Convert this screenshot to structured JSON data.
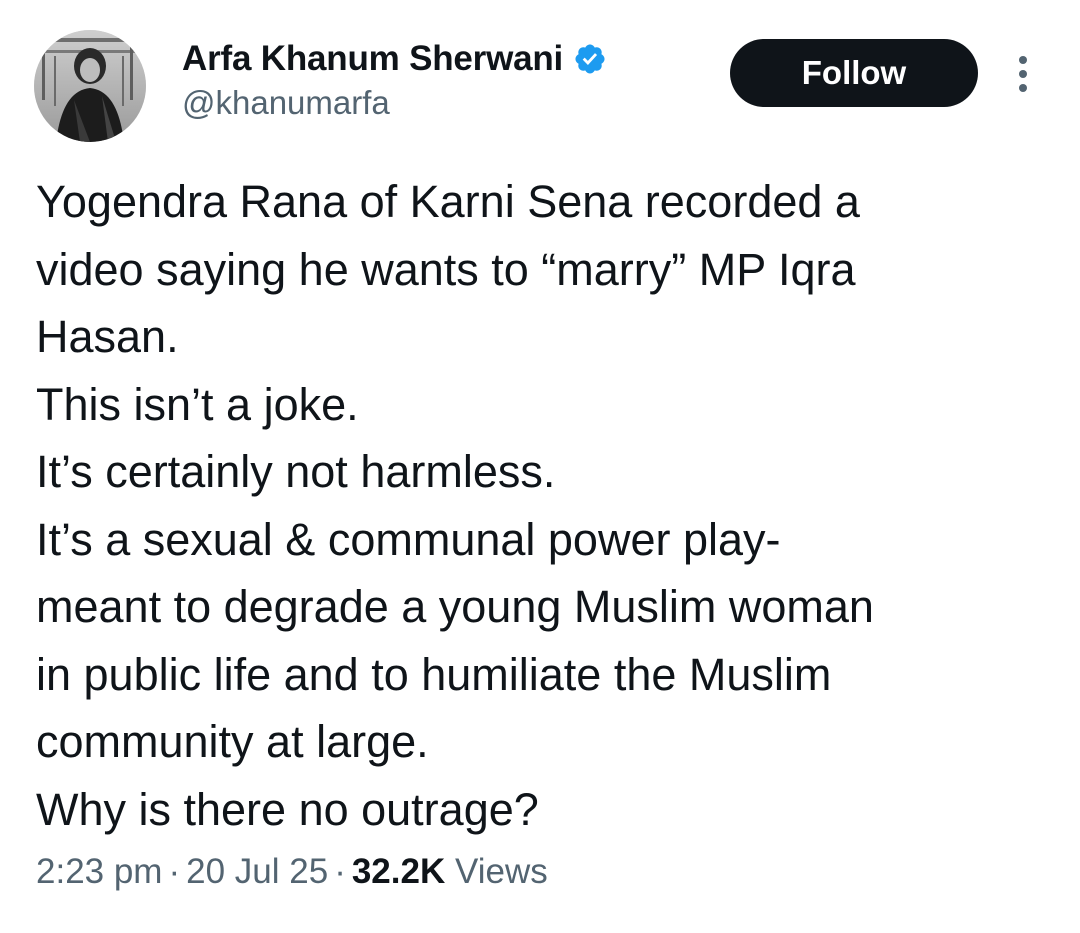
{
  "author": {
    "display_name": "Arfa Khanum Sherwani",
    "handle": "@khanumarfa",
    "verified": true,
    "verified_color": "#1d9bf0"
  },
  "actions": {
    "follow_label": "Follow",
    "more_icon": "more-vertical-icon"
  },
  "tweet": {
    "lines": [
      "Yogendra Rana of Karni Sena recorded a",
      "video saying he wants to “marry” MP Iqra",
      "Hasan.",
      "This isn’t a joke.",
      "It’s certainly not harmless.",
      "It’s a sexual & communal power play-",
      "meant to degrade a young Muslim woman",
      "in public life and to humiliate the Muslim",
      "community at large.",
      "Why is there no outrage?"
    ]
  },
  "meta": {
    "time": "2:23 pm",
    "separator": "·",
    "date": "20 Jul 25",
    "views_count": "32.2K",
    "views_label": "Views"
  },
  "colors": {
    "text_primary": "#0f1419",
    "text_secondary": "#536471",
    "follow_bg": "#0f1419",
    "follow_text": "#ffffff"
  }
}
